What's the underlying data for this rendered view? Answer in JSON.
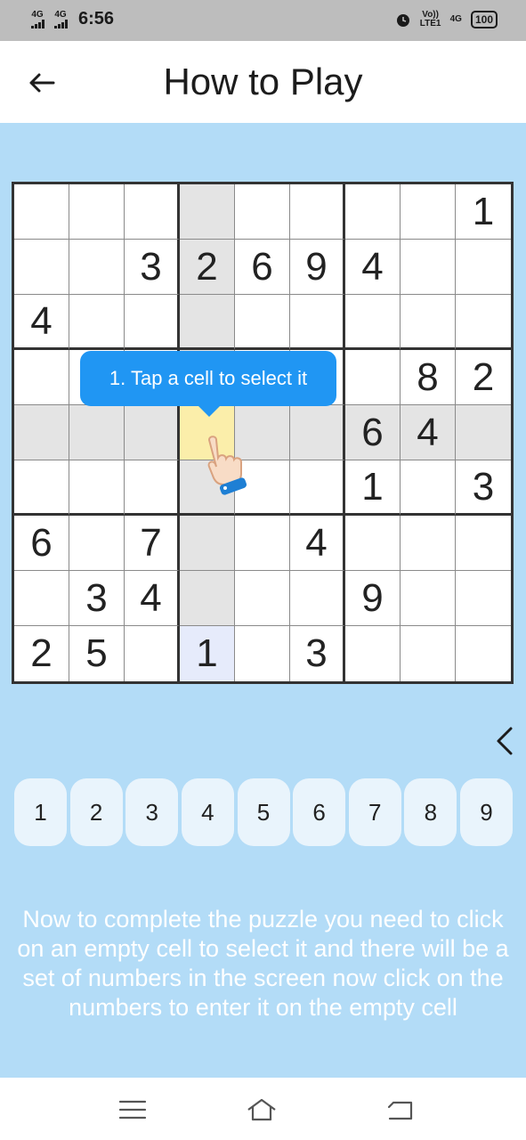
{
  "status_bar": {
    "network_1": "4G",
    "network_2": "4G",
    "time": "6:56",
    "volte": "Vo)) LTE1",
    "network_3": "4G",
    "battery": "100"
  },
  "header": {
    "title": "How to Play"
  },
  "board": {
    "rows": [
      [
        "",
        "",
        "",
        "",
        "",
        "",
        "",
        "",
        "1"
      ],
      [
        "",
        "",
        "3",
        "2",
        "6",
        "9",
        "4",
        "",
        ""
      ],
      [
        "4",
        "",
        "",
        "",
        "",
        "",
        "",
        "",
        ""
      ],
      [
        "",
        "",
        "",
        "",
        "",
        "",
        "",
        "8",
        "2"
      ],
      [
        "",
        "",
        "",
        "",
        "",
        "",
        "6",
        "4",
        ""
      ],
      [
        "",
        "",
        "",
        "",
        "",
        "",
        "1",
        "",
        "3"
      ],
      [
        "6",
        "",
        "7",
        "",
        "",
        "4",
        "",
        "",
        ""
      ],
      [
        "",
        "3",
        "4",
        "",
        "",
        "",
        "9",
        "",
        ""
      ],
      [
        "2",
        "5",
        "",
        "1",
        "",
        "3",
        "",
        "",
        ""
      ]
    ],
    "highlighted_column": 4,
    "highlighted_row": 5,
    "selected_cell": {
      "row": 5,
      "col": 4
    },
    "blue_cell": {
      "row": 9,
      "col": 4
    }
  },
  "tooltip": {
    "text": "1. Tap a cell to select it"
  },
  "numpad": [
    "1",
    "2",
    "3",
    "4",
    "5",
    "6",
    "7",
    "8",
    "9"
  ],
  "instructions": "Now to complete the puzzle you need to click on an empty cell to select it and there will be a set of numbers in the screen now click on the numbers to enter it on the empty cell",
  "colors": {
    "background": "#b3dcf7",
    "tooltip": "#2096f3",
    "selected_cell": "#fbeeaa",
    "highlight": "#e4e4e4"
  },
  "icons": {
    "back": "back-arrow-icon",
    "hand": "pointing-hand-icon",
    "chevron": "chevron-left-icon",
    "menu": "menu-icon",
    "home": "home-icon",
    "recent": "back-nav-icon"
  }
}
